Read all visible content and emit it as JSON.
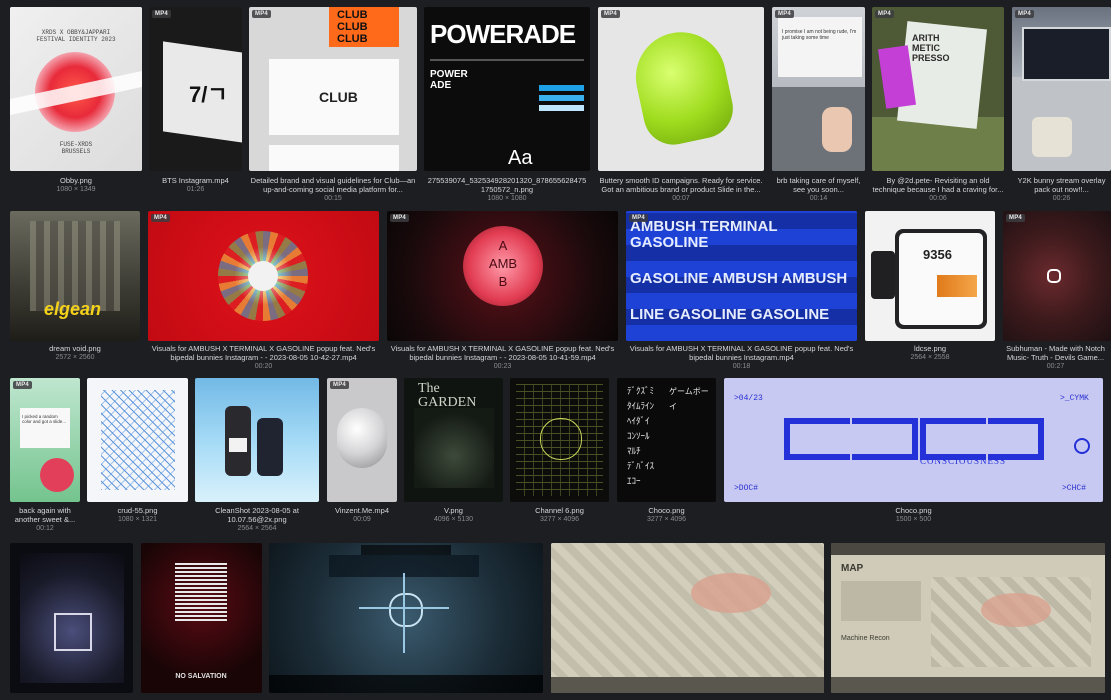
{
  "badge": "MP4",
  "items": [
    {
      "title": "Obby.png",
      "sub": "1080 × 1349",
      "art_text": "XRDS X OBBY&JAPPARI\nFESTIVAL IDENTITY 2023",
      "art_text2": "FUSE-XRDS\nBRUSSELS"
    },
    {
      "title": "BTS Instagram.mp4",
      "sub": "01:26"
    },
    {
      "title": "Detailed brand and visual guidelines for Club—an up-and-coming social media platform for...",
      "sub": "00:15",
      "art_text": "CLUB"
    },
    {
      "title": "275539074_532534928201320_878655628475 1750572_n.png",
      "sub": "1080 × 1080",
      "art_text": "POWERADE",
      "art_text2": "POWER\nADE",
      "art_text3": "Aa"
    },
    {
      "title": "Buttery smooth ID campaigns. Ready for service. Got an ambitious brand or product Slide in the...",
      "sub": "00:07"
    },
    {
      "title": "brb taking care of myself, see you soon...",
      "sub": "00:14"
    },
    {
      "title": "By @2d.pete- Revisiting an old technique because I had a craving for...",
      "sub": "00:06",
      "art_text": "ARITH\nMETIC\nPRESSO"
    },
    {
      "title": "Y2K bunny stream overlay pack out now!!...",
      "sub": "00:26"
    },
    {
      "title": "dream void.png",
      "sub": "2572 × 2560",
      "art_text": "elgean"
    },
    {
      "title": "Visuals for AMBUSH X TERMINAL X GASOLINE popup feat. Ned's bipedal bunnies Instagram - - 2023-08-05 10-42-27.mp4",
      "sub": "00:20"
    },
    {
      "title": "Visuals for AMBUSH X TERMINAL X GASOLINE popup feat. Ned's bipedal bunnies Instagram - - 2023-08-05 10-41-59.mp4",
      "sub": "00:23",
      "art_text": "A\nAMB\nB"
    },
    {
      "title": "Visuals for AMBUSH X TERMINAL X GASOLINE popup feat. Ned's bipedal bunnies Instagram.mp4",
      "sub": "00:18",
      "art_text": "AMBUSH TERMINAL GASOLINE"
    },
    {
      "title": "ldcse.png",
      "sub": "2564 × 2558",
      "art_text": "9356"
    },
    {
      "title": "Subhuman - Made with Notch Music- Truth - Devils Game...",
      "sub": "00:27"
    },
    {
      "title": "back again with another sweet &...",
      "sub": "00:12"
    },
    {
      "title": "crud-55.png",
      "sub": "1080 × 1321"
    },
    {
      "title": "CleanShot 2023-08-05 at 10.07.56@2x.png",
      "sub": "2564 × 2564"
    },
    {
      "title": "Vinzent.Me.mp4",
      "sub": "00:09"
    },
    {
      "title": "V.png",
      "sub": "4096 × 5130",
      "art_text": "The\nGARDEN"
    },
    {
      "title": "Channel 6.png",
      "sub": "3277 × 4096"
    },
    {
      "title": "Choco.png",
      "sub": "3277 × 4096",
      "art_text": "ゲームボーイ"
    },
    {
      "title": "Choco.png",
      "sub": "1500 × 500",
      "art_text": ">04/23",
      "art_text2": ">_CYMK",
      "art_text3": "CONSCIOUSNESS",
      "art_text4": ">DOC#",
      "art_text5": ">CHC#"
    },
    {
      "title": "",
      "sub": ""
    },
    {
      "title": "",
      "sub": "",
      "art_text": "NO SALVATION"
    },
    {
      "title": "",
      "sub": ""
    },
    {
      "title": "",
      "sub": ""
    },
    {
      "title": "",
      "sub": "",
      "art_text": "MAP",
      "art_text2": "Machine Recon"
    }
  ],
  "colors": {
    "background": "#1d1e21",
    "caption": "#d6d7da",
    "subcaption": "#8b8c90"
  }
}
